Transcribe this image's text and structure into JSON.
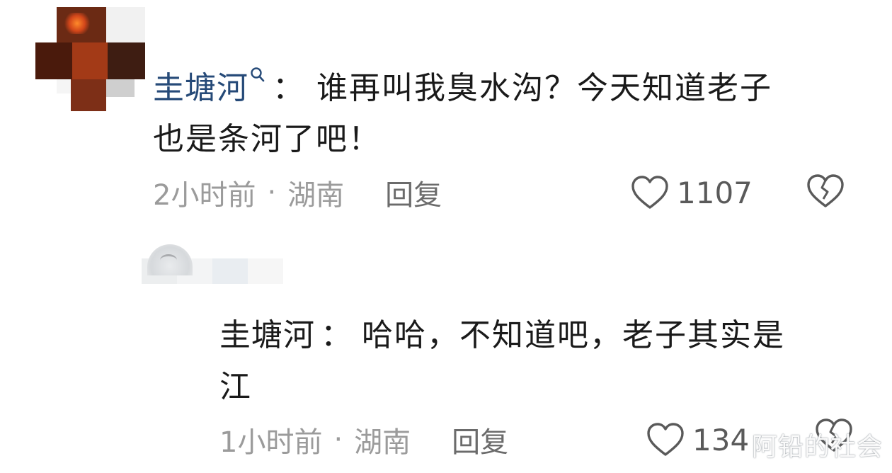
{
  "comment1": {
    "username": "圭塘河",
    "colon": "：",
    "text_line1": "谁再叫我臭水沟？今天知道老子",
    "text_line2": "也是条河了吧！",
    "time": "2小时前",
    "dot": "·",
    "location": "湖南",
    "reply_label": "回复",
    "like_count": "1107"
  },
  "comment2": {
    "username": "圭塘河",
    "colon": "：",
    "text_line1": "哈哈，不知道吧，老子其实是",
    "text_line2": "江",
    "time": "1小时前",
    "dot": "·",
    "location": "湖南",
    "reply_label": "回复",
    "like_count": "134"
  },
  "watermark": "阿铅的社会",
  "icons": {
    "search": "search-icon",
    "like": "heart-icon",
    "dislike": "broken-heart-icon"
  },
  "colors": {
    "username_link": "#264a78",
    "meta_text": "#9b9b9b",
    "reply_text": "#6b6b6b"
  }
}
